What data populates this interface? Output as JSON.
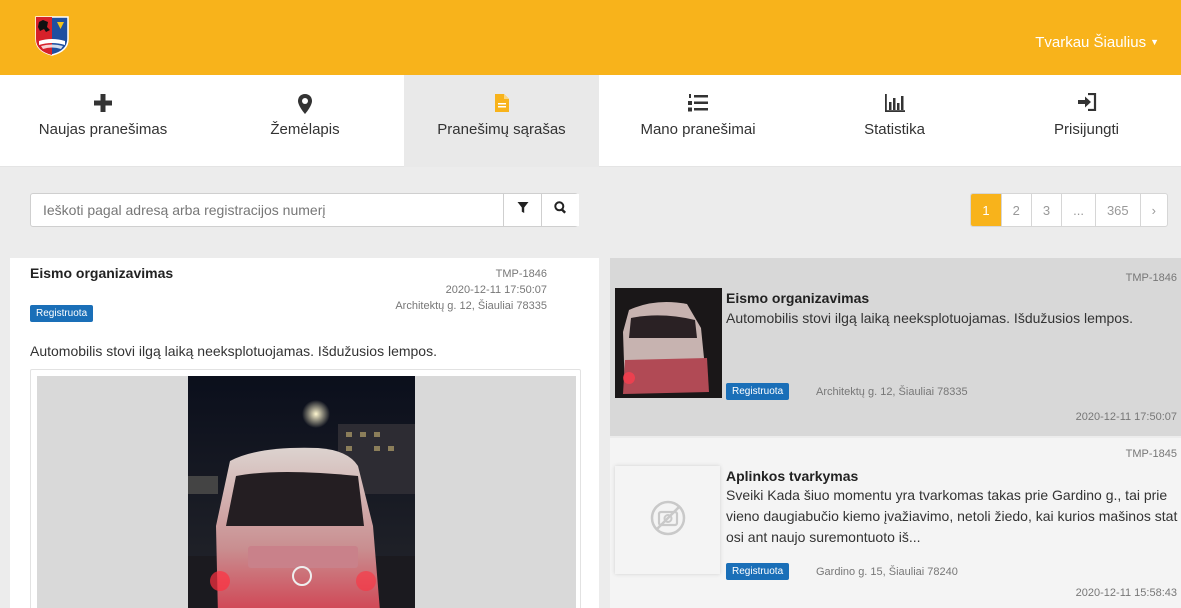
{
  "header": {
    "user_menu_label": "Tvarkau Šiaulius",
    "brand_color": "#f8b31b"
  },
  "nav": {
    "items": [
      {
        "label": "Naujas pranešimas",
        "icon": "plus-icon"
      },
      {
        "label": "Žemėlapis",
        "icon": "map-marker-icon"
      },
      {
        "label": "Pranešimų sąrašas",
        "icon": "file-icon",
        "active": true
      },
      {
        "label": "Mano pranešimai",
        "icon": "numbered-list-icon"
      },
      {
        "label": "Statistika",
        "icon": "bar-chart-icon"
      },
      {
        "label": "Prisijungti",
        "icon": "sign-in-icon"
      }
    ]
  },
  "search": {
    "placeholder": "Ieškoti pagal adresą arba registracijos numerį",
    "value": ""
  },
  "pagination": {
    "pages": [
      "1",
      "2",
      "3",
      "...",
      "365"
    ],
    "current": "1",
    "next_label": "›"
  },
  "detail": {
    "title": "Eismo organizavimas",
    "code": "TMP-1846",
    "date": "2020-12-11 17:50:07",
    "status": "Registruota",
    "address": "Architektų g. 12, Šiauliai 78335",
    "description": "Automobilis stovi ilgą laiką neeksplotuojamas. Išdužusios lempos."
  },
  "list": {
    "items": [
      {
        "code": "TMP-1846",
        "title": "Eismo organizavimas",
        "text": "Automobilis stovi ilgą laiką neeksplotuojamas. Išdužusios lempos.",
        "status": "Registruota",
        "address": "Architektų g. 12, Šiauliai 78335",
        "date": "2020-12-11 17:50:07"
      },
      {
        "code": "TMP-1845",
        "title": "Aplinkos tvarkymas",
        "text": "Sveiki Kada šiuo momentu yra tvarkomas takas prie Gardino g., tai prie vieno daugiabučio kiemo įvažiavimo, netoli žiedo, kai kurios mašinos statosi ant naujo suremontuoto iš...",
        "status": "Registruota",
        "address": "Gardino g. 15, Šiauliai 78240",
        "date": "2020-12-11 15:58:43"
      }
    ]
  },
  "colors": {
    "badge": "#1a6fb8",
    "selected_row": "#d8d8d8",
    "active_tab": "#e9e9e9"
  }
}
